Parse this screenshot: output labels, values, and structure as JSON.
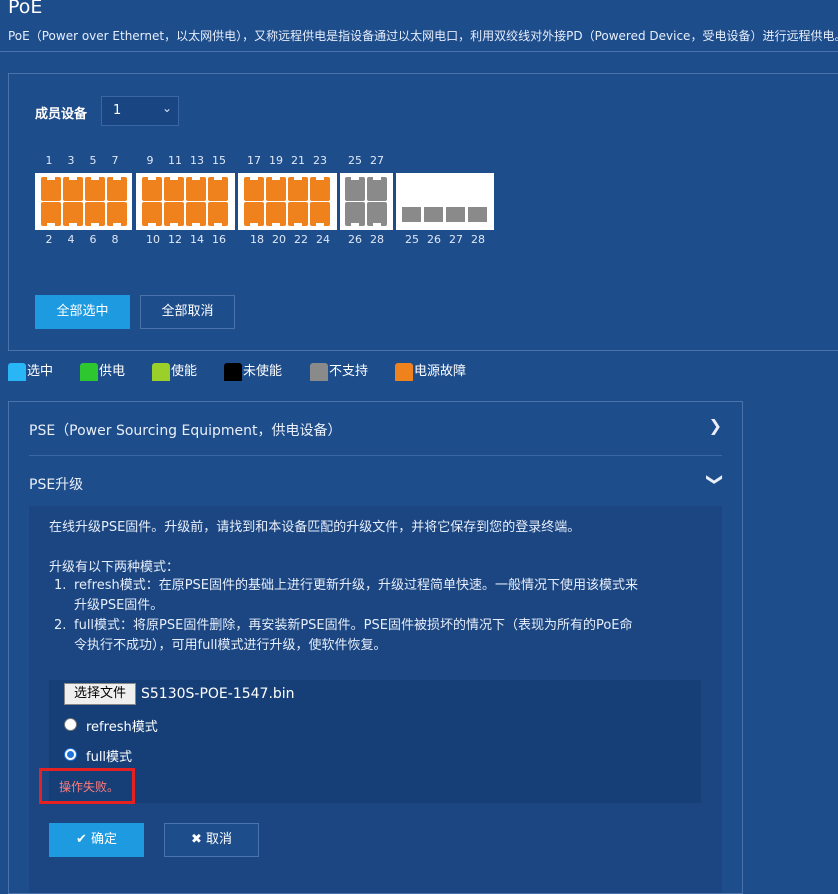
{
  "page": {
    "title": "PoE",
    "description": "PoE（Power over Ethernet，以太网供电），又称远程供电是指设备通过以太网电口，利用双绞线对外接PD（Powered Device，受电设备）进行远程供电。"
  },
  "member": {
    "label": "成员设备",
    "value": "1"
  },
  "ports": {
    "top_numbers": [
      "1",
      "3",
      "5",
      "7",
      "9",
      "11",
      "13",
      "15",
      "17",
      "19",
      "21",
      "23",
      "25",
      "27"
    ],
    "bottom_numbers": [
      "2",
      "4",
      "6",
      "8",
      "10",
      "12",
      "14",
      "16",
      "18",
      "20",
      "22",
      "24",
      "26",
      "28",
      "25",
      "26",
      "27",
      "28"
    ]
  },
  "buttons": {
    "select_all": "全部选中",
    "cancel_all": "全部取消"
  },
  "legend": [
    {
      "label": "选中",
      "color": "#29b6f6"
    },
    {
      "label": "供电",
      "color": "#2fc72f"
    },
    {
      "label": "使能",
      "color": "#9bd02a"
    },
    {
      "label": "未使能",
      "color": "#000000"
    },
    {
      "label": "不支持",
      "color": "#8a8a8a"
    },
    {
      "label": "电源故障",
      "color": "#f0821e"
    }
  ],
  "accordion": {
    "pse": {
      "label": "PSE（Power Sourcing Equipment，供电设备）"
    },
    "upgrade": {
      "label": "PSE升级"
    }
  },
  "upgrade": {
    "intro": "在线升级PSE固件。升级前，请找到和本设备匹配的升级文件，并将它保存到您的登录终端。",
    "modes_title": "升级有以下两种模式：",
    "mode1_num": "1.",
    "mode1_line1": "refresh模式：在原PSE固件的基础上进行更新升级，升级过程简单快速。一般情况下使用该模式来",
    "mode1_line2": "升级PSE固件。",
    "mode2_num": "2.",
    "mode2_line1": "full模式：将原PSE固件删除，再安装新PSE固件。PSE固件被损坏的情况下（表现为所有的PoE命",
    "mode2_line2": "令执行不成功），可用full模式进行升级，使软件恢复。",
    "file_button": "选择文件",
    "file_name": "S5130S-POE-1547.bin",
    "radio_refresh": "refresh模式",
    "radio_full": "full模式",
    "error": "操作失败。",
    "ok": "确定",
    "cancel": "取消"
  }
}
